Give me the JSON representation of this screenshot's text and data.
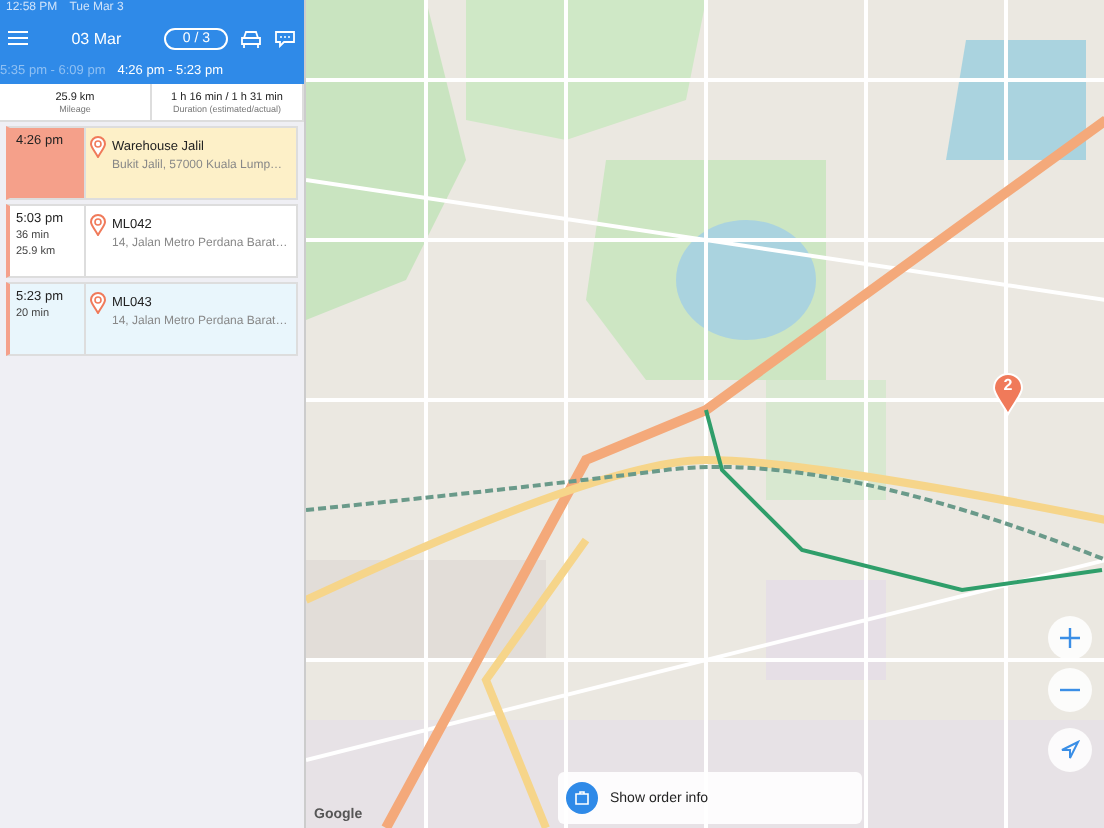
{
  "status_bar": {
    "time": "12:58 PM",
    "date": "Tue Mar 3"
  },
  "header": {
    "date": "03 Mar",
    "counter": "0 / 3"
  },
  "time_ranges": [
    {
      "label": "5:35 pm - 6:09 pm",
      "selected": false
    },
    {
      "label": "4:26 pm - 5:23 pm",
      "selected": true
    }
  ],
  "stats": [
    {
      "value": "25.9 km",
      "label": "Mileage"
    },
    {
      "value": "1 h 16 min / 1 h 31 min",
      "label": "Duration (estimated/actual)"
    }
  ],
  "stops": [
    {
      "time": "4:26 pm",
      "name": "Warehouse Jalil",
      "address": "Bukit Jalil, 57000 Kuala Lump…",
      "selected": true,
      "color": "#fdf0c8"
    },
    {
      "time": "5:03 pm",
      "details": [
        "36 min",
        "25.9 km"
      ],
      "name": "ML042",
      "address": "14, Jalan Metro Perdana Barat…",
      "selected": false,
      "color": "#ffffff"
    },
    {
      "time": "5:23 pm",
      "details": [
        "20 min"
      ],
      "name": "ML043",
      "address": "14, Jalan Metro Perdana Barat…",
      "selected": false,
      "color": "#e9f6fc"
    }
  ],
  "map": {
    "pin_label": "2",
    "attribution": "Google",
    "order_button": "Show order info"
  }
}
